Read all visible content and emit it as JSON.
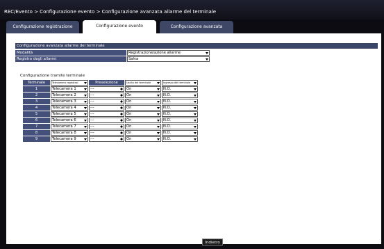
{
  "breadcrumb": "REC/Evento > Configurazione evento > Configurazione avanzata allarme del terminale",
  "tabs": [
    {
      "label": "Configurazione registrazione",
      "active": false
    },
    {
      "label": "Configurazione evento",
      "active": true
    },
    {
      "label": "Configurazione avanzata",
      "active": false
    }
  ],
  "section": {
    "title": "Configurazione avanzata allarme del terminale",
    "rows": [
      {
        "label": "Modalità",
        "value": "Registrazione/azione allarme"
      },
      {
        "label": "Registro degli allarmi",
        "value": "Salva"
      }
    ]
  },
  "terminal_config": {
    "title": "Configurazione tramite terminale",
    "headers": {
      "terminal": "Terminale",
      "camera": "Telecamera registrazi",
      "preset": "Preselezione",
      "output": "Uscita del terminale",
      "input": "Ingresso del terminale"
    },
    "rows": [
      {
        "num": "1",
        "camera": "Telecamera 1",
        "preset": "---",
        "output": "On",
        "input": "N.O."
      },
      {
        "num": "2",
        "camera": "Telecamera 2",
        "preset": "---",
        "output": "On",
        "input": "N.O."
      },
      {
        "num": "3",
        "camera": "Telecamera 3",
        "preset": "---",
        "output": "On",
        "input": "N.O."
      },
      {
        "num": "4",
        "camera": "Telecamera 4",
        "preset": "---",
        "output": "On",
        "input": "N.O."
      },
      {
        "num": "5",
        "camera": "Telecamera 5",
        "preset": "---",
        "output": "On",
        "input": "N.O."
      },
      {
        "num": "6",
        "camera": "Telecamera 6",
        "preset": "---",
        "output": "On",
        "input": "N.O."
      },
      {
        "num": "7",
        "camera": "Telecamera 7",
        "preset": "---",
        "output": "On",
        "input": "N.O."
      },
      {
        "num": "8",
        "camera": "Telecamera 8",
        "preset": "---",
        "output": "On",
        "input": "N.O."
      },
      {
        "num": "9",
        "camera": "Telecamera 9",
        "preset": "---",
        "output": "On",
        "input": "N.O."
      }
    ]
  },
  "back_label": "Indietro",
  "colors": {
    "header_blue": "#45507a",
    "section_bar": "#3a4466",
    "background": "#0c0c12"
  }
}
